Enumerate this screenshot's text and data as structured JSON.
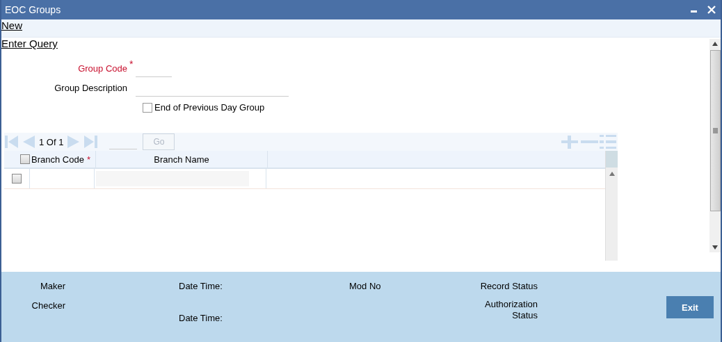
{
  "window": {
    "title": "EOC Groups"
  },
  "actions": [
    {
      "label": "New"
    },
    {
      "label": "Enter Query"
    }
  ],
  "form": {
    "group_code": {
      "label": "Group Code",
      "required": true,
      "required_mark": "*"
    },
    "group_description": {
      "label": "Group Description",
      "required": false
    },
    "end_of_previous_day": {
      "label": "End of Previous Day Group",
      "checked": false
    }
  },
  "grid": {
    "pager": "1 Of 1",
    "go_button": "Go",
    "select_all_checked": false,
    "columns": [
      {
        "label": "Branch Code",
        "required_mark": "*"
      },
      {
        "label": "Branch Name"
      }
    ],
    "rows": [
      {
        "checked": false
      }
    ]
  },
  "footer": {
    "maker": "Maker",
    "checker": "Checker",
    "date_time_1": "Date Time:",
    "date_time_2": "Date Time:",
    "mod_no": "Mod No",
    "record_status": "Record Status",
    "authorization_status": "Authorization Status",
    "exit_button": "Exit"
  }
}
